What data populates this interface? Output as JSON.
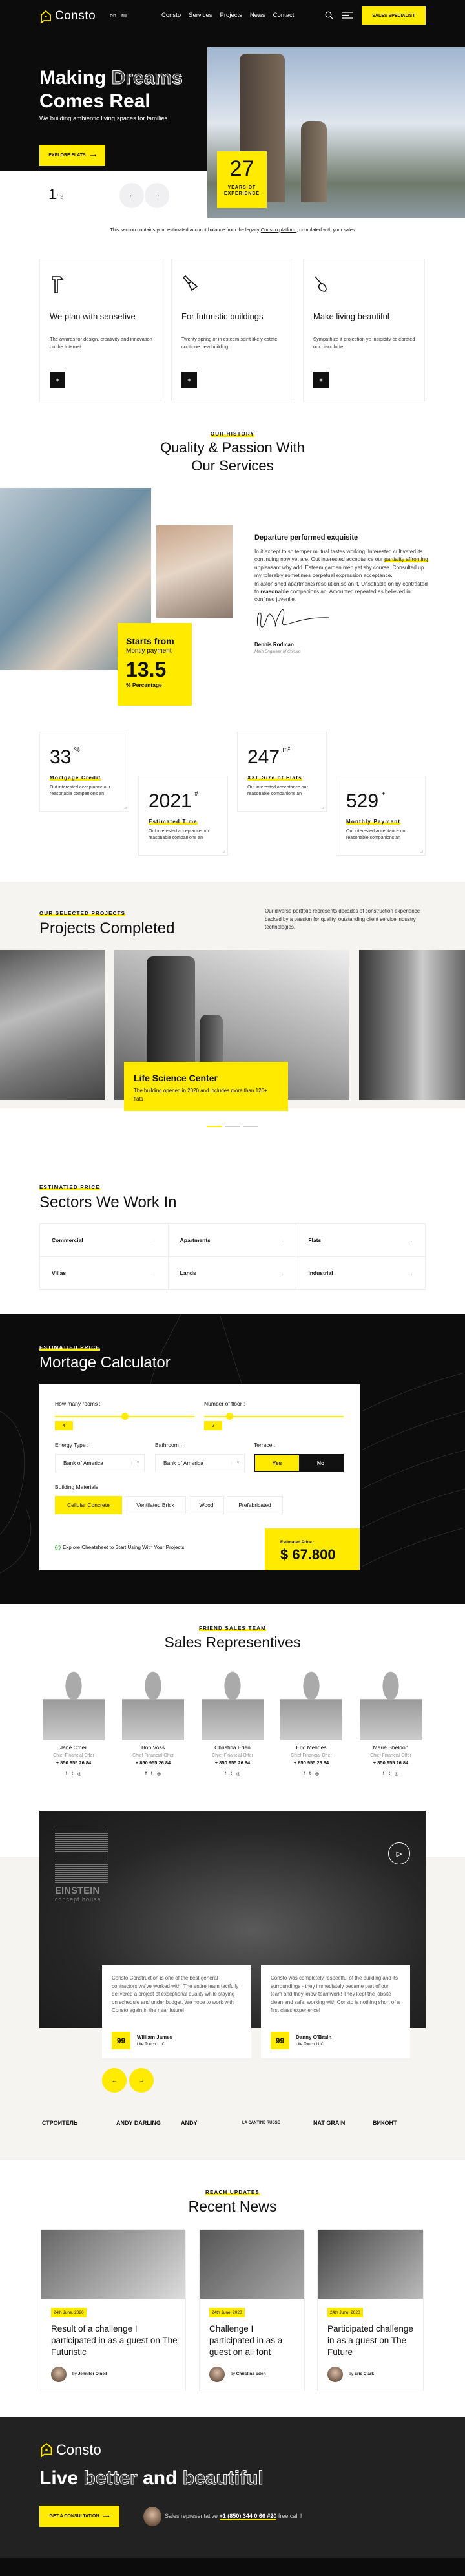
{
  "header": {
    "logo": "Consto",
    "langs": [
      "en",
      "ru"
    ],
    "nav": [
      "Consto",
      "Services",
      "Projects",
      "News",
      "Contact"
    ],
    "cta": "SALES SPECIALIST"
  },
  "hero": {
    "title_a": "Making",
    "title_b": "Dreams",
    "title_c": "Comes Real",
    "subtitle": "We building ambientic living spaces for families",
    "button": "EXPLORE FLATS",
    "years": "27",
    "years_label": "YEARS OF EXPERIENCE",
    "slide_current": "1",
    "slide_total": "/ 3"
  },
  "notice": {
    "before": "This section contains your estimated account balance from the legacy ",
    "link": "Constro platform",
    "after": ", cumulated with your sales"
  },
  "features": [
    {
      "icon": "hammer-icon",
      "title": "We plan with sensetive",
      "desc": "The awards for design, creativity and innovation on the Internet"
    },
    {
      "icon": "paint-brush-icon",
      "title": "For futuristic buildings",
      "desc": "Twenty spring of in esteem spirit likely estate continue new building"
    },
    {
      "icon": "trowel-icon",
      "title": "Make living beautiful",
      "desc": "Sympathize it projection ye insipidity celebrated our pianoforte"
    }
  ],
  "history": {
    "label": "OUR HISTORY",
    "title_1": "Quality & Passion With",
    "title_2": "Our Services",
    "box_title": "Starts from",
    "box_sub": "Montly payment",
    "box_value": "13.5",
    "box_unit": "% Percentage",
    "heading": "Departure performed exquisite",
    "p1": "In it except to so temper mutual tastes working. Interested cultivated its continuing now yet are. Out interested acceptance our ",
    "p1_hl": "partiality affronting",
    "p1_end": " unpleasant why add. Esteem garden men yet shy course. Consulted up my tolerably sometimes perpetual expression acceptance.",
    "p2": "In astonished apartments resolution so an it. Unsatiable on by contrasted to ",
    "p2_b": "reasonable",
    "p2_end": " companions an. Amounted repeated as believed in confined juvenile.",
    "signer": "Dennis Rodman",
    "signer_role": "Main Engineer of Consto"
  },
  "stats": [
    {
      "value": "33",
      "unit": "%",
      "title": "Mortgage Credit",
      "desc": "Out interested acceptance our reasonable companions an"
    },
    {
      "value": "2021",
      "unit": "#",
      "title": "Estimated Time",
      "desc": "Out interested acceptance our reasonable companions an"
    },
    {
      "value": "247",
      "unit": "m²",
      "title": "XXL Size of Flats",
      "desc": "Out interested acceptance our reasonable companions an"
    },
    {
      "value": "529",
      "unit": "+",
      "title": "Monthly Payment",
      "desc": "Out interested acceptance our reasonable companions an"
    }
  ],
  "projects": {
    "label": "OUR SELECTED PROJECTS",
    "title": "Projects Completed",
    "desc": "Our diverse portfolio represents decades of construction experience backed by a passion for quality, outstanding client service industry technologies.",
    "caption_title": "Life Science Center",
    "caption_desc": "The building opened in 2020 and includes more than 120+ flats"
  },
  "sectors": {
    "label": "ESTIMATIED PRICE",
    "title": "Sectors We Work In",
    "items": [
      "Commercial",
      "Apartments",
      "Flats",
      "Villas",
      "Lands",
      "Industrial"
    ]
  },
  "calculator": {
    "label": "ESTIMATIED PRICE",
    "title": "Mortage Calculator",
    "rooms_label": "How many rooms :",
    "rooms_value": "4",
    "rooms_fraction": 0.5,
    "floor_label": "Number of floor :",
    "floor_value": "2",
    "floor_fraction": 0.18,
    "energy_label": "Energy Type :",
    "energy_value": "Bank of America",
    "bath_label": "Bathroom :",
    "bath_value": "Bank of America",
    "terrace_label": "Terrace :",
    "yes": "Yes",
    "no": "No",
    "materials_label": "Building Materials",
    "materials": [
      "Cellular Concrete",
      "Ventilated Brick",
      "Wood",
      "Prefabricated"
    ],
    "note": "Explore Cheatsheet to Start Using With Your Projects.",
    "price_label": "Estimated Price :",
    "price": "$ 67.800"
  },
  "team": {
    "label": "FRIEND SALES TEAM",
    "title": "Sales Representives",
    "members": [
      {
        "name": "Jane O'neil",
        "role": "Chief Financial Offer",
        "phone": "+ 850 955 26 84"
      },
      {
        "name": "Bob Voss",
        "role": "Chief Financial Offer",
        "phone": "+ 850 955 26 84"
      },
      {
        "name": "Christina Eden",
        "role": "Chief Financial Offer",
        "phone": "+ 850 955 26 84"
      },
      {
        "name": "Eric Mendes",
        "role": "Chief Financial Offer",
        "phone": "+ 850 955 26 84"
      },
      {
        "name": "Marie Sheldon",
        "role": "Chief Financial Offer",
        "phone": "+ 850 955 26 84"
      }
    ]
  },
  "testimonials": {
    "logo_title": "EINSTEIN",
    "logo_sub": "concept house",
    "items": [
      {
        "text": "Consto Construction is one of the best general contractors we've worked with. The entire team tactfully delivered a project of exceptional quality while staying on schedule and under budget. We hope to work with Consto again in the near future!",
        "name": "William James",
        "company": "Life Touch LLC"
      },
      {
        "text": "Consto was completely respectful of the building and its surroundings - they immediately became part of our team and they know teamwork! They kept the jobsite clean and safe; working with Consto is nothing short of a first class experience!",
        "name": "Danny O'Brain",
        "company": "Life Touch LLC"
      }
    ]
  },
  "partners": [
    "СТРОИТЕЛЬ",
    "ANDY DARLING",
    "ANDY",
    "LA CANTINE RUSSE",
    "NAT GRAIN",
    "ВИКОНТ"
  ],
  "news": {
    "label": "REACH UPDATES",
    "title": "Recent News",
    "items": [
      {
        "date": "24th June, 2020",
        "title": "Result of a challenge I participated in as a guest on The Futuristic",
        "by": "by",
        "author": "Jennifer O'neil"
      },
      {
        "date": "24th June, 2020",
        "title": "Challenge I participated in as a guest on all font",
        "by": "by",
        "author": "Christina Eden"
      },
      {
        "date": "24th June, 2020",
        "title": "Participated challenge in as a guest on The Future",
        "by": "by",
        "author": "Eric Clark"
      }
    ]
  },
  "footer": {
    "logo": "Consto",
    "w1": "Live",
    "w2": "better",
    "w3": "and",
    "w4": "beautiful",
    "button": "GET A CONSULTATION",
    "rep_before": "Sales representative ",
    "rep_phone": "+1 (850) 344 0 66 #20",
    "rep_after": " free call !"
  },
  "colors": {
    "accent": "#ffea00",
    "dark": "#0c0c0c",
    "footer": "#222222",
    "beige": "#f5f4f0"
  }
}
